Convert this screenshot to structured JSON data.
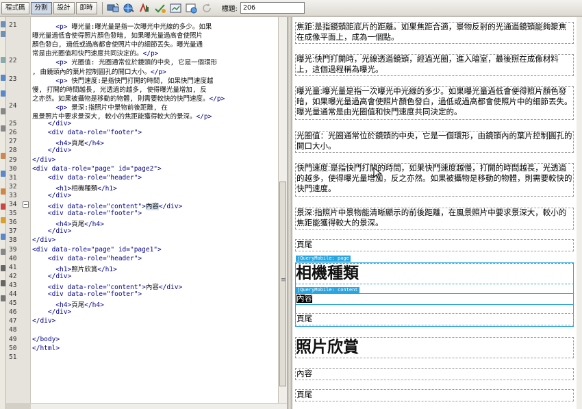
{
  "toolbar": {
    "code_label": "程式碼",
    "split_label": "分割",
    "design_label": "設計",
    "live_label": "即時",
    "title_label": "標題:",
    "title_value": "206",
    "icons": [
      "multiscreen-icon",
      "globe-icon",
      "debug-icon",
      "validate-icon",
      "visual-aids-icon",
      "refresh-design-icon",
      "reload-icon"
    ]
  },
  "code": {
    "top_partial": "...",
    "lines": [
      {
        "n": "21",
        "parts": [
          {
            "t": "      <p>",
            "c": "ctag"
          },
          {
            "t": " 曝光量:曝光量是指一次曝光中光線的多少。如果",
            "c": "ctx"
          }
        ]
      },
      {
        "n": "",
        "parts": [
          {
            "t": "曝光量過低會使得照片顏色發暗, 如果曝光量過高會使照片",
            "c": "ctx"
          }
        ]
      },
      {
        "n": "",
        "parts": [
          {
            "t": "顏色發白, 過低或過高都會使照片中的細節丟失。曝光量通",
            "c": "ctx"
          }
        ]
      },
      {
        "n": "",
        "parts": [
          {
            "t": "常是由光圈值和快門速度共同決定的。",
            "c": "ctx"
          },
          {
            "t": "</p>",
            "c": "ctag"
          }
        ]
      },
      {
        "n": "22",
        "parts": [
          {
            "t": "      <p>",
            "c": "ctag"
          },
          {
            "t": " 光圈值: 光圈通常位於鏡頭的中央, 它是一個環形",
            "c": "ctx"
          }
        ]
      },
      {
        "n": "",
        "parts": [
          {
            "t": ", 由鏡頭內的葉片控制圓孔的開口大小。",
            "c": "ctx"
          },
          {
            "t": "</p>",
            "c": "ctag"
          }
        ]
      },
      {
        "n": "23",
        "parts": [
          {
            "t": "      <p>",
            "c": "ctag"
          },
          {
            "t": " 快門速度:是指快門打開的時間, 如果快門速度越",
            "c": "ctx"
          }
        ]
      },
      {
        "n": "",
        "parts": [
          {
            "t": "慢, 打開的時間越長, 光透過的越多, 使得曝光量增加, 反",
            "c": "ctx"
          }
        ]
      },
      {
        "n": "",
        "parts": [
          {
            "t": "之亦然。如果被攝物是移動的物體, 則需要較快的快門速度。",
            "c": "ctx"
          },
          {
            "t": "</p>",
            "c": "ctag"
          }
        ]
      },
      {
        "n": "24",
        "parts": [
          {
            "t": "      <p>",
            "c": "ctag"
          },
          {
            "t": " 景深:指照片中景物前後距離, 在",
            "c": "ctx"
          }
        ]
      },
      {
        "n": "",
        "parts": [
          {
            "t": "風景照片中要求景深大, 較小的焦距能獲得較大的景深。",
            "c": "ctx"
          },
          {
            "t": "</p>",
            "c": "ctag"
          }
        ]
      },
      {
        "n": "25",
        "parts": [
          {
            "t": "    </div>",
            "c": "ctag"
          }
        ]
      },
      {
        "n": "26",
        "parts": [
          {
            "t": "    <div data-role=\"footer\">",
            "c": "ctag"
          }
        ]
      },
      {
        "n": "27",
        "parts": [
          {
            "t": "      <h4>",
            "c": "ctag"
          },
          {
            "t": "頁尾",
            "c": "ctx"
          },
          {
            "t": "</h4>",
            "c": "ctag"
          }
        ]
      },
      {
        "n": "28",
        "parts": [
          {
            "t": "    </div>",
            "c": "ctag"
          }
        ]
      },
      {
        "n": "29",
        "parts": [
          {
            "t": "</div>",
            "c": "ctag"
          }
        ]
      },
      {
        "n": "30",
        "parts": [
          {
            "t": "<div data-role=\"page\" id=\"page2\">",
            "c": "ctag"
          }
        ]
      },
      {
        "n": "31",
        "parts": [
          {
            "t": "    <div data-role=\"header\">",
            "c": "ctag"
          }
        ]
      },
      {
        "n": "32",
        "parts": [
          {
            "t": "      <h1>",
            "c": "ctag"
          },
          {
            "t": "相機種類",
            "c": "ctx"
          },
          {
            "t": "</h1>",
            "c": "ctag"
          }
        ]
      },
      {
        "n": "33",
        "parts": [
          {
            "t": "    </div>",
            "c": "ctag"
          }
        ]
      },
      {
        "n": "34",
        "parts": [
          {
            "t": "    <div data-role=\"content\">",
            "c": "ctag"
          },
          {
            "t": "內容",
            "c": "ctx hl"
          },
          {
            "t": "</div>",
            "c": "ctag"
          }
        ]
      },
      {
        "n": "35",
        "parts": [
          {
            "t": "    <div data-role=\"footer\">",
            "c": "ctag"
          }
        ]
      },
      {
        "n": "36",
        "parts": [
          {
            "t": "      <h4>",
            "c": "ctag"
          },
          {
            "t": "頁尾",
            "c": "ctx"
          },
          {
            "t": "</h4>",
            "c": "ctag"
          }
        ]
      },
      {
        "n": "37",
        "parts": [
          {
            "t": "    </div>",
            "c": "ctag"
          }
        ]
      },
      {
        "n": "38",
        "parts": [
          {
            "t": "</div>",
            "c": "ctag"
          }
        ]
      },
      {
        "n": "39",
        "parts": [
          {
            "t": "<div data-role=\"page\" id=\"page1\">",
            "c": "ctag"
          }
        ]
      },
      {
        "n": "40",
        "parts": [
          {
            "t": "    <div data-role=\"header\">",
            "c": "ctag"
          }
        ]
      },
      {
        "n": "41",
        "parts": [
          {
            "t": "      <h1>",
            "c": "ctag"
          },
          {
            "t": "照片欣賞",
            "c": "ctx"
          },
          {
            "t": "</h1>",
            "c": "ctag"
          }
        ]
      },
      {
        "n": "42",
        "parts": [
          {
            "t": "    </div>",
            "c": "ctag"
          }
        ]
      },
      {
        "n": "43",
        "parts": [
          {
            "t": "    <div data-role=\"content\">",
            "c": "ctag"
          },
          {
            "t": "內容",
            "c": "ctx"
          },
          {
            "t": "</div>",
            "c": "ctag"
          }
        ]
      },
      {
        "n": "44",
        "parts": [
          {
            "t": "    <div data-role=\"footer\">",
            "c": "ctag"
          }
        ]
      },
      {
        "n": "45",
        "parts": [
          {
            "t": "      <h4>",
            "c": "ctag"
          },
          {
            "t": "頁尾",
            "c": "ctx"
          },
          {
            "t": "</h4>",
            "c": "ctag"
          }
        ]
      },
      {
        "n": "46",
        "parts": [
          {
            "t": "    </div>",
            "c": "ctag"
          }
        ]
      },
      {
        "n": "47",
        "parts": [
          {
            "t": "</div>",
            "c": "ctag"
          }
        ]
      },
      {
        "n": "48",
        "parts": []
      },
      {
        "n": "49",
        "parts": [
          {
            "t": "</body>",
            "c": "ctag"
          }
        ]
      },
      {
        "n": "50",
        "parts": [
          {
            "t": "</html>",
            "c": "ctag"
          }
        ]
      },
      {
        "n": "51",
        "parts": []
      }
    ]
  },
  "design": {
    "p_focal": "焦距:是指鏡頭距底片的距離。如果焦距合適，景物反射的光通過鏡頭能夠聚焦在成像平面上，成為一個點。",
    "p_exposure_time": "曝光:快門打開時，光線透過鏡頭，經過光圈，進入暗室，最後照在成像材料上，這個過程稱為曝光。",
    "p_exposure": "曝光量:曝光量是指一次曝光中光線的多少。如果曝光量過低會使得照片顏色發暗，如果曝光量過高會使照片顏色發白，過低或過高都會使照片中的細節丟失。曝光量通常是由光圈值和快門速度共同決定的。",
    "p_aperture": "光圈值：光圈通常位於鏡頭的中央，它是一個環形，由鏡頭內的葉片控制圓孔的開口大小。",
    "p_shutter": "快門速度:是指快門打開的時間，如果快門速度越慢，打開的時間越長，光透過的越多，使得曝光量增加，反之亦然。如果被攝物是移動的物體，則需要較快的快門速度。",
    "p_dof": "景深:指照片中景物能清晰顯示的前後距離，在風景照片中要求景深大，較小的焦距能獲得較大的景深。",
    "footer1": "頁尾",
    "page_tag": "jQueryMobile: page",
    "heading2": "相機種類",
    "content_tag": "jQueryMobile: content",
    "content2": "內容",
    "footer2": "頁尾",
    "heading3": "照片欣賞",
    "content3": "內容",
    "footer3": "頁尾"
  }
}
